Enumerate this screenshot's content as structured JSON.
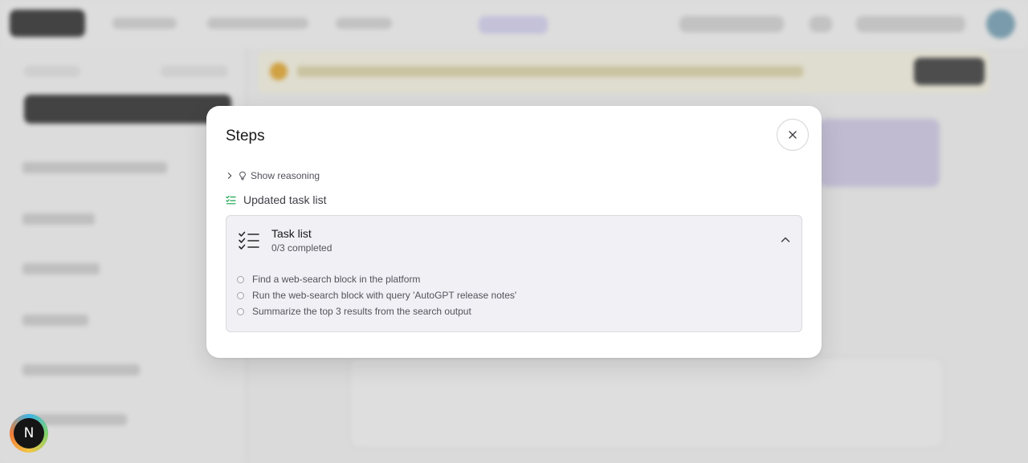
{
  "modal": {
    "title": "Steps",
    "show_reasoning_label": "Show reasoning",
    "updated_label": "Updated task list",
    "task_list": {
      "title": "Task list",
      "progress": "0/3 completed",
      "items": [
        {
          "text": "Find a web-search block in the platform",
          "completed": false
        },
        {
          "text": "Run the web-search block with query 'AutoGPT release notes'",
          "completed": false
        },
        {
          "text": "Summarize the top 3 results from the search output",
          "completed": false
        }
      ]
    }
  },
  "avatar": {
    "initial": "N"
  },
  "colors": {
    "accent_green": "#16a34a",
    "modal_bg": "#ffffff",
    "card_bg": "#f1f1f5"
  },
  "icons": {
    "close": "close-icon",
    "chevron_right": "chevron-right-icon",
    "lightbulb": "lightbulb-icon",
    "list_check": "list-check-icon",
    "task_list": "task-list-icon",
    "chevron_up": "chevron-up-icon"
  }
}
